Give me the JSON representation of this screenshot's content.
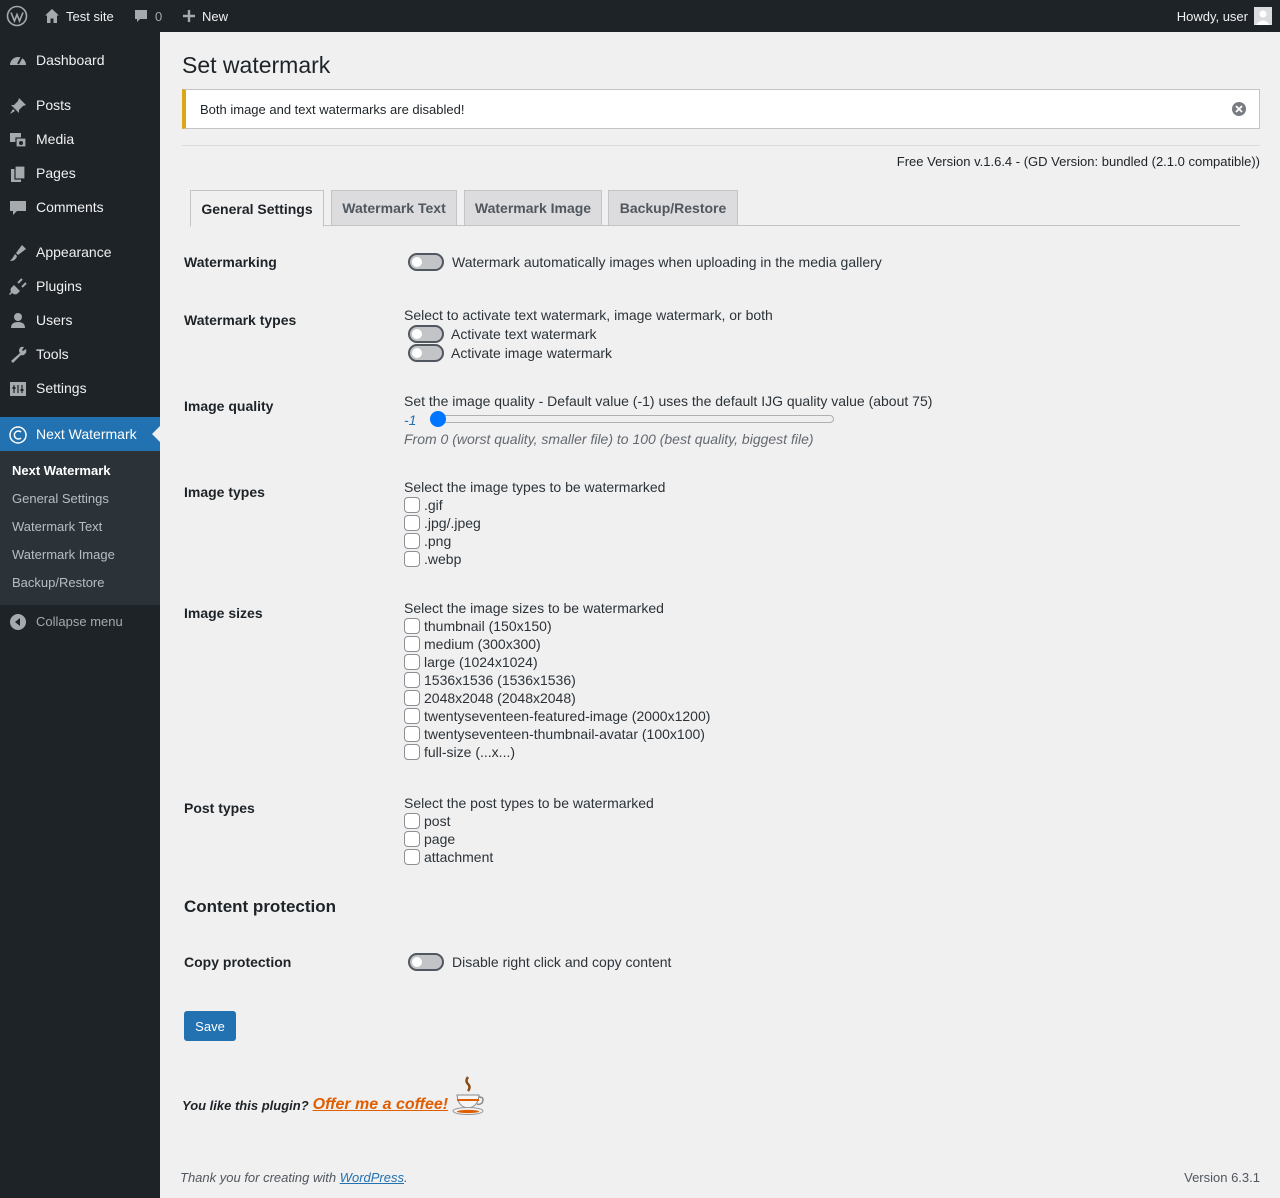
{
  "adminbar": {
    "site": "Test site",
    "comments_count": "0",
    "new_label": "New",
    "howdy": "Howdy, user"
  },
  "sidebar": {
    "items": [
      {
        "label": "Dashboard",
        "icon": "dashboard-icon"
      },
      {
        "label": "Posts",
        "icon": "pin-icon"
      },
      {
        "label": "Media",
        "icon": "media-icon"
      },
      {
        "label": "Pages",
        "icon": "page-icon"
      },
      {
        "label": "Comments",
        "icon": "comment-icon"
      },
      {
        "label": "Appearance",
        "icon": "brush-icon"
      },
      {
        "label": "Plugins",
        "icon": "plugin-icon"
      },
      {
        "label": "Users",
        "icon": "user-icon"
      },
      {
        "label": "Tools",
        "icon": "wrench-icon"
      },
      {
        "label": "Settings",
        "icon": "settings-icon"
      },
      {
        "label": "Next Watermark",
        "icon": "copyright-icon"
      }
    ],
    "submenu": [
      "Next Watermark",
      "General Settings",
      "Watermark Text",
      "Watermark Image",
      "Backup/Restore"
    ],
    "collapse": "Collapse menu"
  },
  "page": {
    "title": "Set watermark",
    "notice": "Both image and text watermarks are disabled!",
    "version": "Free Version v.1.6.4 - (GD Version: bundled (2.1.0 compatible))",
    "tabs": [
      "General Settings",
      "Watermark Text",
      "Watermark Image",
      "Backup/Restore"
    ],
    "watermarking": {
      "label": "Watermarking",
      "text": "Watermark automatically images when uploading in the media gallery"
    },
    "types": {
      "label": "Watermark types",
      "desc": "Select to activate text watermark, image watermark, or both",
      "text": "Activate text watermark",
      "image": "Activate image watermark"
    },
    "quality": {
      "label": "Image quality",
      "desc": "Set the image quality - Default value (-1) uses the default IJG quality value (about 75)",
      "value": "-1",
      "note": "From 0 (worst quality, smaller file) to 100 (best quality, biggest file)",
      "min": -1,
      "max": 100
    },
    "image_types": {
      "label": "Image types",
      "desc": "Select the image types to be watermarked",
      "options": [
        ".gif",
        ".jpg/.jpeg",
        ".png",
        ".webp"
      ]
    },
    "image_sizes": {
      "label": "Image sizes",
      "desc": "Select the image sizes to be watermarked",
      "options": [
        "thumbnail (150x150)",
        "medium (300x300)",
        "large (1024x1024)",
        "1536x1536 (1536x1536)",
        "2048x2048 (2048x2048)",
        "twentyseventeen-featured-image (2000x1200)",
        "twentyseventeen-thumbnail-avatar (100x100)",
        "full-size (...x...)"
      ]
    },
    "post_types": {
      "label": "Post types",
      "desc": "Select the post types to be watermarked",
      "options": [
        "post",
        "page",
        "attachment"
      ]
    },
    "content_protection": "Content protection",
    "copy": {
      "label": "Copy protection",
      "text": "Disable right click and copy content"
    },
    "save": "Save",
    "coffee_text": "You like this plugin?",
    "coffee_link": "Offer me a coffee!"
  },
  "footer": {
    "thanks_prefix": "Thank you for creating with",
    "wp_link": "WordPress",
    "thanks_suffix": ".",
    "version": "Version 6.3.1"
  }
}
